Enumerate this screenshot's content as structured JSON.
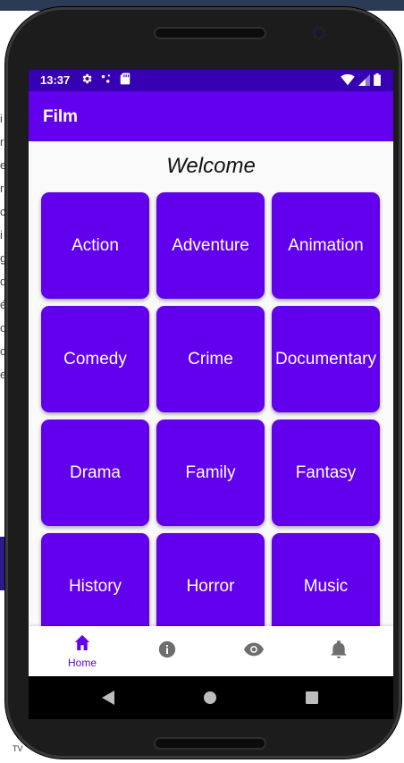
{
  "background": {
    "left_fragment_chars": [
      "i",
      "",
      "",
      "r",
      "e",
      "r",
      "c",
      "",
      "i",
      "",
      "g",
      "d",
      "é",
      "o",
      "c",
      "",
      "",
      "e"
    ],
    "bottom_fragment": "TV"
  },
  "status_bar": {
    "time": "13:37",
    "icons_left": [
      "settings-icon",
      "data-dots-icon",
      "sd-card-icon"
    ],
    "icons_right": [
      "wifi-icon",
      "signal-icon",
      "battery-icon"
    ]
  },
  "app_bar": {
    "title": "Film"
  },
  "main": {
    "heading": "Welcome",
    "genres": [
      "Action",
      "Adventure",
      "Animation",
      "Comedy",
      "Crime",
      "Documentary",
      "Drama",
      "Family",
      "Fantasy",
      "History",
      "Horror",
      "Music"
    ]
  },
  "bottom_nav": {
    "items": [
      {
        "label": "Home",
        "icon": "home-icon",
        "active": true
      },
      {
        "label": "",
        "icon": "info-icon",
        "active": false
      },
      {
        "label": "",
        "icon": "eye-icon",
        "active": false
      },
      {
        "label": "",
        "icon": "bell-icon",
        "active": false
      }
    ]
  },
  "system_nav": {
    "buttons": [
      "back-icon",
      "home-circle-icon",
      "recents-icon"
    ]
  },
  "colors": {
    "primary": "#6200ee",
    "primary_dark": "#3700b3",
    "nav_inactive": "#6e6e6e"
  }
}
